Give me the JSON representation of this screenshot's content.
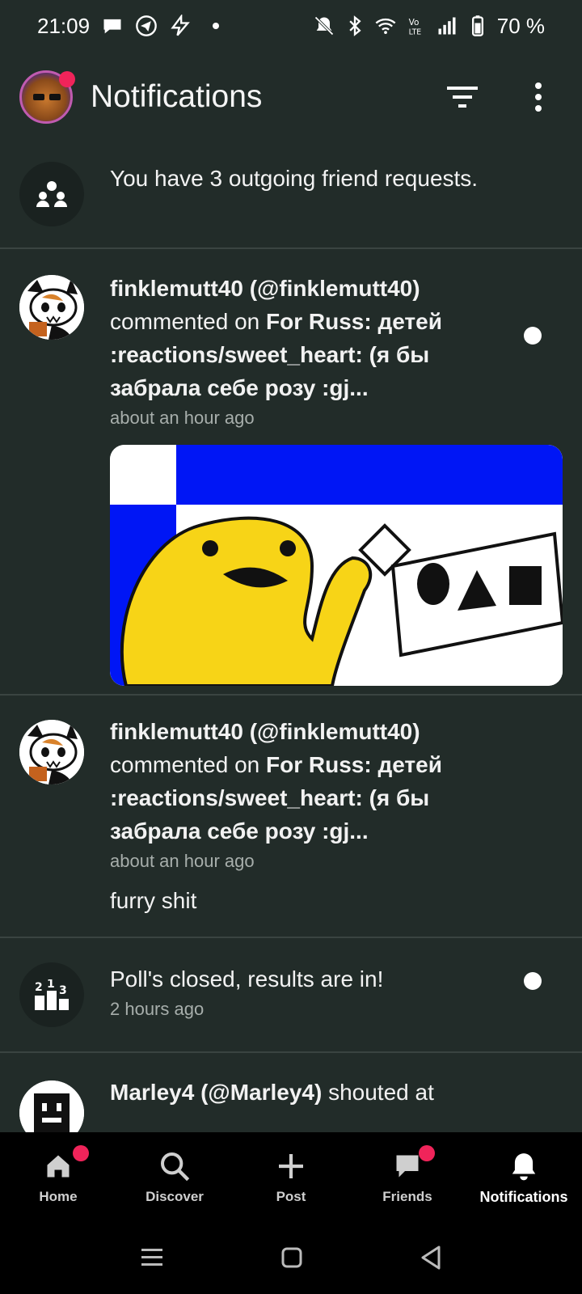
{
  "status_bar": {
    "time": "21:09",
    "battery": "70 %",
    "icons": [
      "chat-bubble-icon",
      "telegram-icon",
      "bolt-icon",
      "mute-icon",
      "bluetooth-icon",
      "wifi-icon",
      "volte-icon",
      "signal-icon",
      "battery-icon"
    ]
  },
  "header": {
    "title": "Notifications",
    "filter_icon": "filter-icon",
    "more_icon": "more-vertical-icon"
  },
  "notifications": [
    {
      "type": "friend-requests",
      "text": "You have 3 outgoing friend requests."
    },
    {
      "type": "comment",
      "user": "finklemutt40 (@finklemutt40)",
      "action": " commented on ",
      "target": "For Russ: детей :reactions/sweet_heart: (я бы забрала себе розу :gj...",
      "time": "about an hour ago",
      "unread": true,
      "has_image": true
    },
    {
      "type": "comment",
      "user": "finklemutt40 (@finklemutt40)",
      "action": " commented on ",
      "target": "For Russ: детей :reactions/sweet_heart: (я бы забрала себе розу :gj...",
      "time": "about an hour ago",
      "body": "furry shit"
    },
    {
      "type": "poll",
      "text": "Poll's closed, results are in!",
      "time": "2 hours ago",
      "unread": true
    },
    {
      "type": "shout",
      "user": "Marley4 (@Marley4)",
      "action": " shouted at"
    }
  ],
  "bottom_nav": [
    {
      "label": "Home",
      "icon": "home-icon",
      "badge": true
    },
    {
      "label": "Discover",
      "icon": "search-icon",
      "badge": false
    },
    {
      "label": "Post",
      "icon": "plus-icon",
      "badge": false
    },
    {
      "label": "Friends",
      "icon": "chat-icon",
      "badge": true
    },
    {
      "label": "Notifications",
      "icon": "bell-icon",
      "badge": false,
      "active": true
    }
  ],
  "colors": {
    "background": "#222c29",
    "badge": "#f0245a",
    "divider": "#3a4441"
  }
}
